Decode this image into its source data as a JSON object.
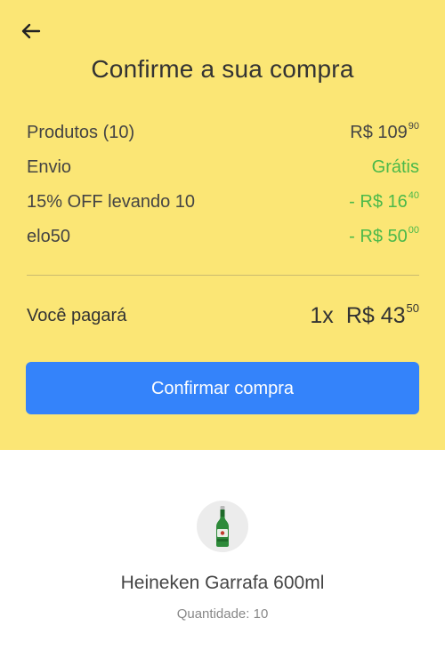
{
  "header": {
    "back_icon": "arrow-left-icon",
    "title": "Confirme a sua compra"
  },
  "summary": {
    "rows": [
      {
        "label": "Produtos (10)",
        "value_main": "R$ 109",
        "value_cents": "90",
        "color": "#444444"
      },
      {
        "label": "Envio",
        "value_main": "Grátis",
        "value_cents": "",
        "color": "#4bb94a"
      },
      {
        "label": "15% OFF levando 10",
        "value_main": "- R$ 16",
        "value_cents": "40",
        "color": "#4bb94a"
      },
      {
        "label": "elo50",
        "value_main": "- R$ 50",
        "value_cents": "00",
        "color": "#4bb94a"
      }
    ],
    "total_label": "Você pagará",
    "total_qty": "1x",
    "total_main": "R$ 43",
    "total_cents": "50"
  },
  "confirm_button": {
    "label": "Confirmar compra",
    "color": "#3483fa"
  },
  "product": {
    "image_icon": "beer-bottle-icon",
    "name": "Heineken Garrafa 600ml",
    "quantity": "Quantidade: 10"
  },
  "colors": {
    "header_bg": "#fbe675",
    "green": "#4bb94a"
  }
}
